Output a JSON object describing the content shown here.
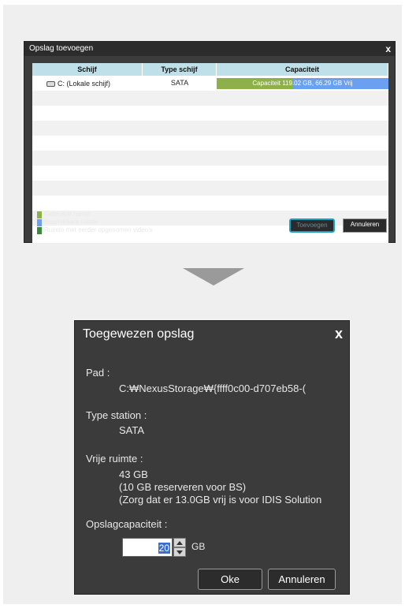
{
  "dialog1": {
    "title": "Opslag toevoegen",
    "close_glyph": "x",
    "columns": [
      "Schijf",
      "Type schijf",
      "Capaciteit"
    ],
    "rows": [
      {
        "disk": "C: (Lokale schijf)",
        "type": "SATA",
        "capacity": "Capaciteit 119.02 GB, 66.29 GB Vrij",
        "used_fraction": 0.44
      }
    ],
    "legend": [
      {
        "label": "Gebruikte ruimte",
        "color": "#8db04a"
      },
      {
        "label": "Beschikbare ruimte",
        "color": "#6aa0ef"
      },
      {
        "label": "Ruimte met eerder opgenomen video's",
        "color": "#3a8a3a"
      }
    ],
    "add_label": "Toevoegen",
    "cancel_label": "Annuleren"
  },
  "dialog2": {
    "title": "Toegewezen opslag",
    "close_glyph": "x",
    "path_label": "Pad :",
    "path_value": "C:₩NexusStorage₩{ffff0c00-d707eb58-(",
    "station_label": "Type station :",
    "station_value": "SATA",
    "free_label": "Vrije ruimte :",
    "free_lines": [
      "43 GB",
      "(10 GB reserveren voor BS)",
      "(Zorg dat er 13.0GB vrij is voor IDIS Solution"
    ],
    "capacity_label": "Opslagcapaciteit :",
    "capacity_value": "20",
    "capacity_unit": "GB",
    "ok_label": "Oke",
    "cancel_label": "Annuleren"
  },
  "colors": {
    "accent_highlight": "#1aa3bd",
    "header_bg": "#bfe0e9",
    "dialog_bg": "#3b3b3b"
  }
}
